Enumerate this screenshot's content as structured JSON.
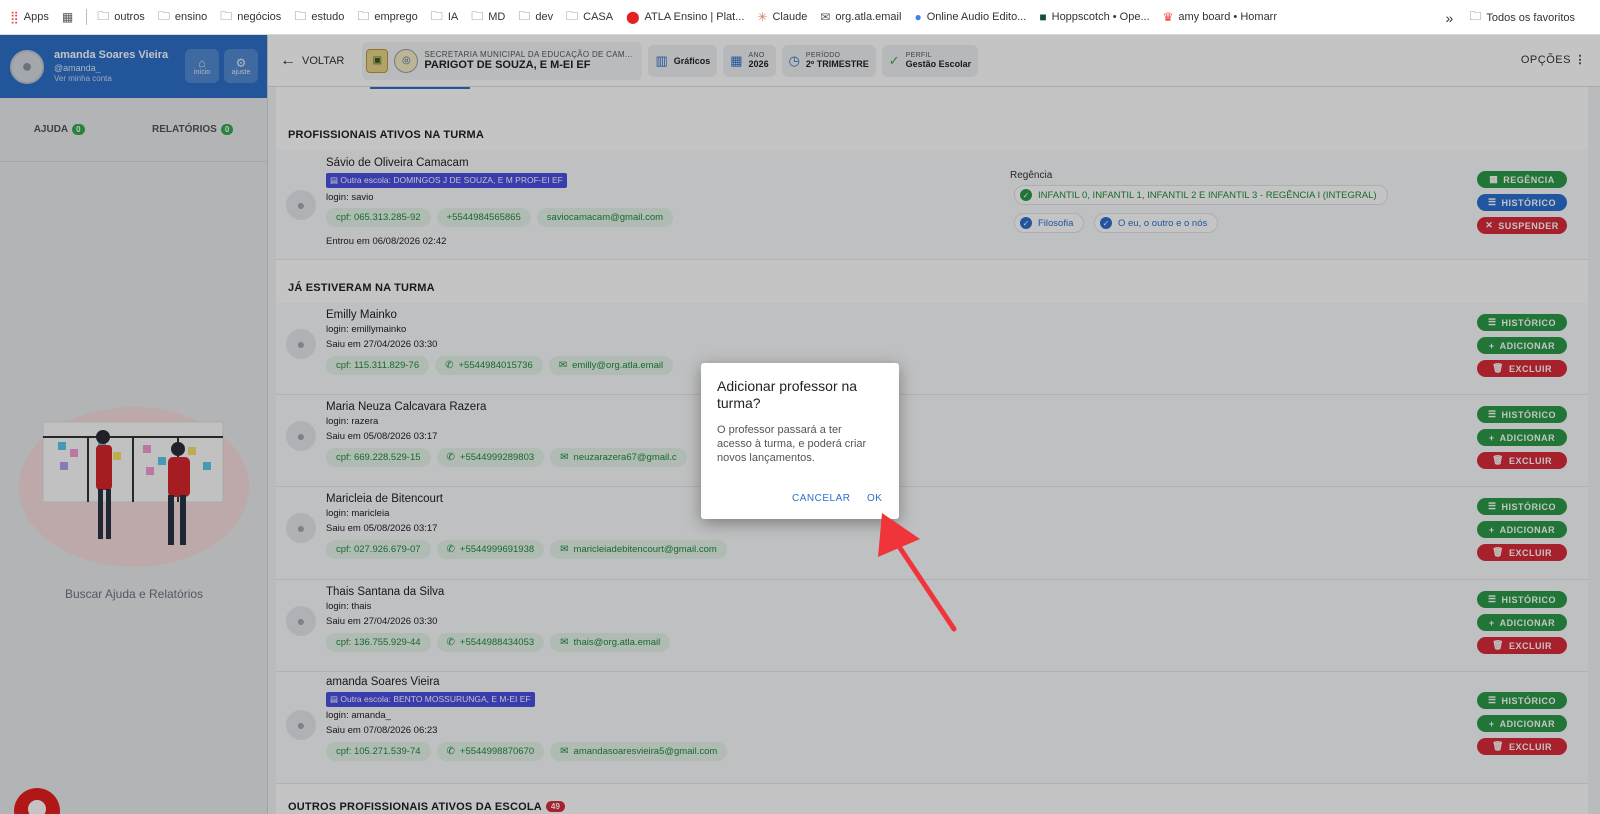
{
  "bookmarks": {
    "apps": "Apps",
    "items": [
      {
        "label": "outros"
      },
      {
        "label": "ensino"
      },
      {
        "label": "negócios"
      },
      {
        "label": "estudo"
      },
      {
        "label": "emprego"
      },
      {
        "label": "IA"
      },
      {
        "label": "MD"
      },
      {
        "label": "dev"
      },
      {
        "label": "CASA"
      },
      {
        "label": "ATLA Ensino | Plat..."
      },
      {
        "label": "Claude"
      },
      {
        "label": "org.atla.email"
      },
      {
        "label": "Online Audio Edito..."
      },
      {
        "label": "Hoppscotch • Ope..."
      },
      {
        "label": "amy board • Homarr"
      }
    ],
    "more": "»",
    "all": "Todos os favoritos"
  },
  "user": {
    "name": "amanda Soares Vieira",
    "handle": "@amanda_",
    "link": "Ver minha conta",
    "btn_home": "início",
    "btn_settings": "ajuste"
  },
  "help": {
    "ajuda": "AJUDA",
    "ajuda_count": "0",
    "relatorios": "RELATÓRIOS",
    "relatorios_count": "0",
    "search_text": "Buscar Ajuda e Relatórios"
  },
  "topbar": {
    "back": "VOLTAR",
    "school_line1": "SECRETARIA MUNICIPAL DA EDUCAÇÃO DE CAM...",
    "school_line2": "PARIGOT DE SOUZA, E M-EI EF",
    "graficos": "Gráficos",
    "ano_label": "ANO",
    "ano_value": "2026",
    "periodo_label": "PERÍODO",
    "periodo_value": "2º TRIMESTRE",
    "perfil_label": "PERFIL",
    "perfil_value": "Gestão Escolar",
    "opcoes": "OPÇÕES"
  },
  "active": {
    "title": "PROFISSIONAIS ATIVOS NA TURMA",
    "person": {
      "name": "Sávio de Oliveira Camacam",
      "school": "Outra escola: DOMINGOS J DE SOUZA, E M PROF-EI EF",
      "login": "login: savio",
      "cpf": "cpf: 065.313.285-92",
      "phone": "+5544984565865",
      "email": "saviocamacam@gmail.com",
      "entered": "Entrou em 06/08/2026 02:42",
      "regencia_label": "Regência",
      "regencia_main": "INFANTIL 0, INFANTIL 1, INFANTIL 2 E INFANTIL 3 - REGÊNCIA I (INTEGRAL)",
      "subject1": "Filosofia",
      "subject2": "O eu, o outro e o nós",
      "btn1": "REGÊNCIA",
      "btn2": "HISTÓRICO",
      "btn3": "SUSPENDER"
    }
  },
  "former": {
    "title": "JÁ ESTIVERAM NA TURMA",
    "people": [
      {
        "name": "Emilly Mainko",
        "login": "login: emillymainko",
        "left": "Saiu em 27/04/2026 03:30",
        "cpf": "cpf: 115.311.829-76",
        "phone": "+5544984015736",
        "email": "emilly@org.atla.email"
      },
      {
        "name": "Maria Neuza Calcavara Razera",
        "login": "login: razera",
        "left": "Saiu em 05/08/2026 03:17",
        "cpf": "cpf: 669.228.529-15",
        "phone": "+5544999289803",
        "email": "neuzarazera67@gmail.c"
      },
      {
        "name": "Maricleia de Bitencourt",
        "login": "login: maricleia",
        "left": "Saiu em 05/08/2026 03:17",
        "cpf": "cpf: 027.926.679-07",
        "phone": "+5544999691938",
        "email": "maricleiadebitencourt@gmail.com"
      },
      {
        "name": "Thais Santana da Silva",
        "login": "login: thais",
        "left": "Saiu em 27/04/2026 03:30",
        "cpf": "cpf: 136.755.929-44",
        "phone": "+5544988434053",
        "email": "thais@org.atla.email"
      },
      {
        "name": "amanda Soares Vieira",
        "school": "Outra escola: BENTO MOSSURUNGA, E M-EI EF",
        "login": "login: amanda_",
        "left": "Saiu em 07/08/2026 06:23",
        "cpf": "cpf: 105.271.539-74",
        "phone": "+5544998870670",
        "email": "amandasoaresvieira5@gmail.com"
      }
    ],
    "btn_hist": "HISTÓRICO",
    "btn_add": "ADICIONAR",
    "btn_del": "EXCLUIR"
  },
  "others": {
    "title": "OUTROS PROFISSIONAIS ATIVOS DA ESCOLA",
    "count": "49"
  },
  "dialog": {
    "title": "Adicionar professor na turma?",
    "body": "O professor passará a ter acesso à turma, e poderá criar novos lançamentos.",
    "cancel": "CANCELAR",
    "ok": "OK"
  },
  "colors": {
    "brand": "#2d6fc9",
    "success": "#2b9a48",
    "danger": "#d92b3a",
    "arrow": "#f0353a"
  }
}
